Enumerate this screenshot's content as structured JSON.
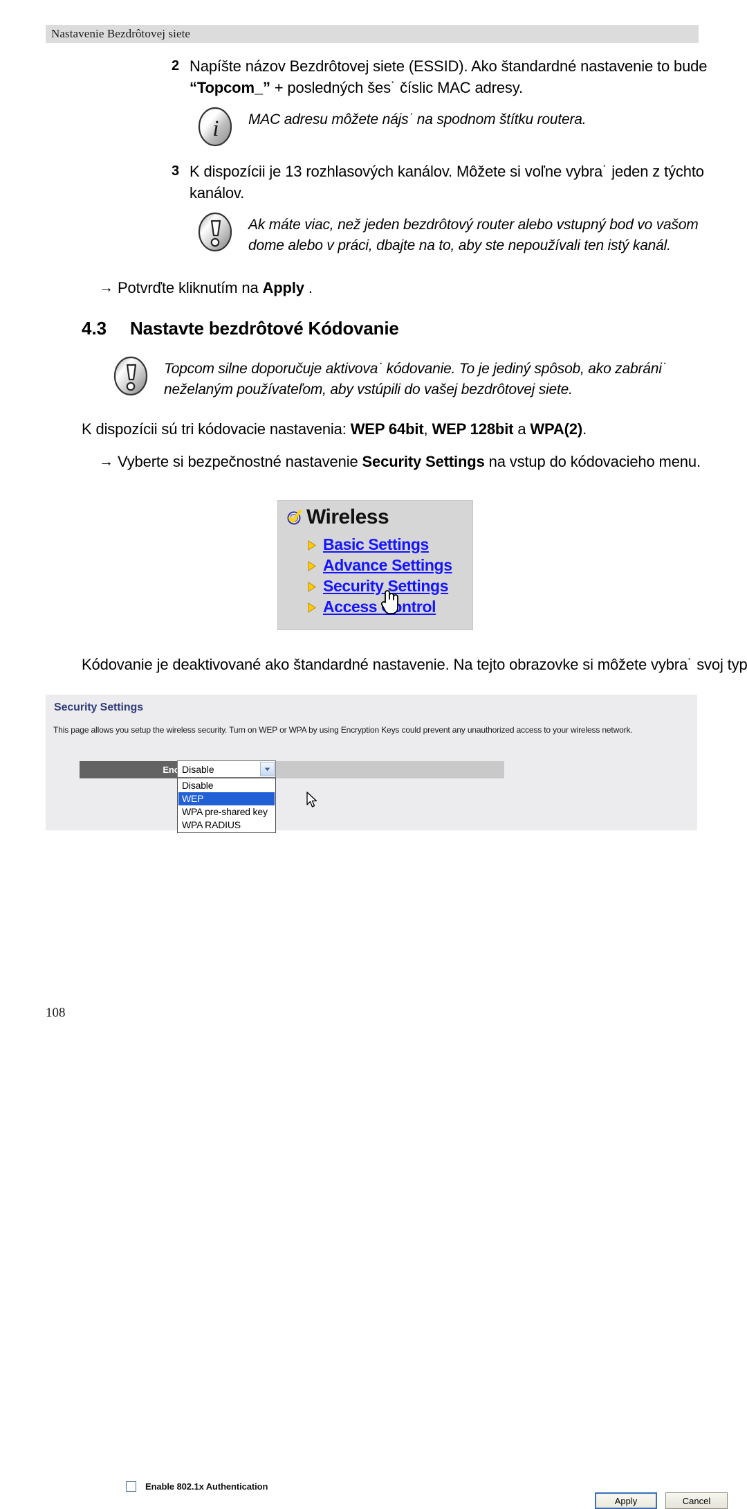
{
  "header": {
    "title": "Nastavenie Bezdrôtovej siete"
  },
  "steps": [
    {
      "number": "2",
      "text_before": "Napíšte názov Bezdrôtovej siete (ESSID). Ako štandardné nastavenie to bude ",
      "bold": "“Topcom_”",
      "text_after": " + posledných šes˙ číslic MAC adresy."
    },
    {
      "number": "3",
      "text_before": "K dispozícii je 13 rozhlasových kanálov. Môžete si voľne vybra˙ jeden z týchto kanálov.",
      "bold": "",
      "text_after": ""
    }
  ],
  "notes": {
    "info_note": {
      "icon": "info-icon",
      "text": "MAC adresu môžete nájs˙ na spodnom štítku routera."
    },
    "channel_warning": {
      "icon": "warning-icon",
      "text": "Ak máte viac, než jeden bezdrôtový router alebo vstupný bod vo vašom dome alebo v práci, dbajte na to, aby ste nepoužívali ten istý kanál."
    },
    "encryption_warning": {
      "icon": "warning-icon",
      "text": "Topcom silne doporučuje aktivova˙ kódovanie. To je jediný spôsob, ako zabráni˙ neželaným používateľom, aby vstúpili do vašej bezdrôtovej siete."
    }
  },
  "apply_bullet": {
    "arrow": "→",
    "text_before": "Potvrďte kliknutím na ",
    "bold": "Apply",
    "text_after": " ."
  },
  "section": {
    "number": "4.3",
    "title": "Nastavte bezdrôtové Kódovanie"
  },
  "encryption_options_paragraph": {
    "text_before": "K dispozícii sú tri kódovacie nastavenia: ",
    "bold1": "WEP 64bit",
    "mid1": ", ",
    "bold2": "WEP 128bit",
    "mid2": " a ",
    "bold3": "WPA(2)",
    "text_after": "."
  },
  "security_bullet": {
    "arrow": "→",
    "text_before": "Vyberte si bezpečnostné nastavenie ",
    "bold": "Security Settings",
    "text_after": " na vstup do kódovacieho menu."
  },
  "default_paragraph": {
    "text": "Kódovanie je deaktivované ako štandardné nastavenie. Na tejto obrazovke si môžete vybra˙ svoj typ kódovania."
  },
  "wireless_menu": {
    "title": "Wireless",
    "title_icon": "check-circle-icon",
    "bullet_icon": "triangle-right-icon",
    "cursor_icon": "hand-pointer-cursor",
    "link_color": "#1414ff",
    "bullet_color": "#ffcc00",
    "background": "#d6d6d6",
    "items": [
      {
        "label": "Basic Settings"
      },
      {
        "label": "Advance Settings"
      },
      {
        "label": "Security Settings"
      },
      {
        "label": "Access Control"
      }
    ]
  },
  "security_panel": {
    "title": "Security Settings",
    "title_color": "#2f3c7a",
    "description": "This page allows you setup the wireless security. Turn on WEP or WPA by using Encryption Keys could prevent any unauthorized access to your wireless network.",
    "encryption": {
      "label": "Encryption :",
      "label_bg": "#636363",
      "selected_value": "Disable",
      "dropdown_icon": "chevron-down-icon",
      "open": true,
      "options": [
        {
          "label": "Disable",
          "selected": false
        },
        {
          "label": "WEP",
          "selected": true
        },
        {
          "label": "WPA pre-shared key",
          "selected": false
        },
        {
          "label": "WPA RADIUS",
          "selected": false
        }
      ],
      "highlight_color": "#2160d4"
    },
    "auth_checkbox": {
      "label": "Enable 802.1x Authentication",
      "checked": false
    },
    "buttons": {
      "apply": "Apply",
      "cancel": "Cancel"
    },
    "cursor_icon": "arrow-cursor"
  },
  "footer": {
    "page_number": "108"
  }
}
